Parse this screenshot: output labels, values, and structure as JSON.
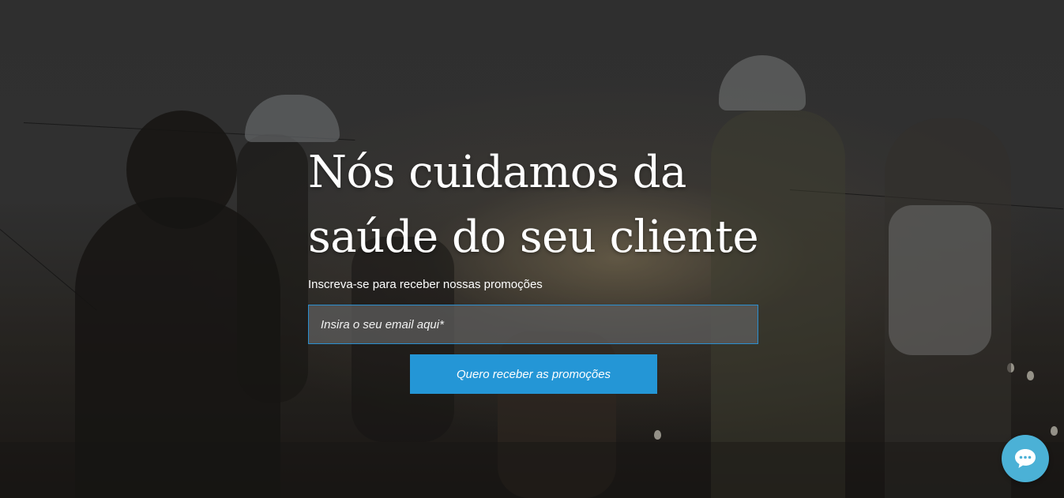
{
  "hero": {
    "headline_line1": "Nós cuidamos da",
    "headline_line2": "saúde do seu cliente",
    "subtitle": "Inscreva-se para receber nossas promoções"
  },
  "form": {
    "email_placeholder": "Insira o seu email aqui*",
    "email_value": "",
    "submit_label": "Quero receber as promoções"
  },
  "chat_widget": {
    "icon": "chat-bubble-icon"
  },
  "colors": {
    "accent": "#2496d6",
    "chat": "#4bb1d6",
    "input_border": "#2b8fd0"
  }
}
